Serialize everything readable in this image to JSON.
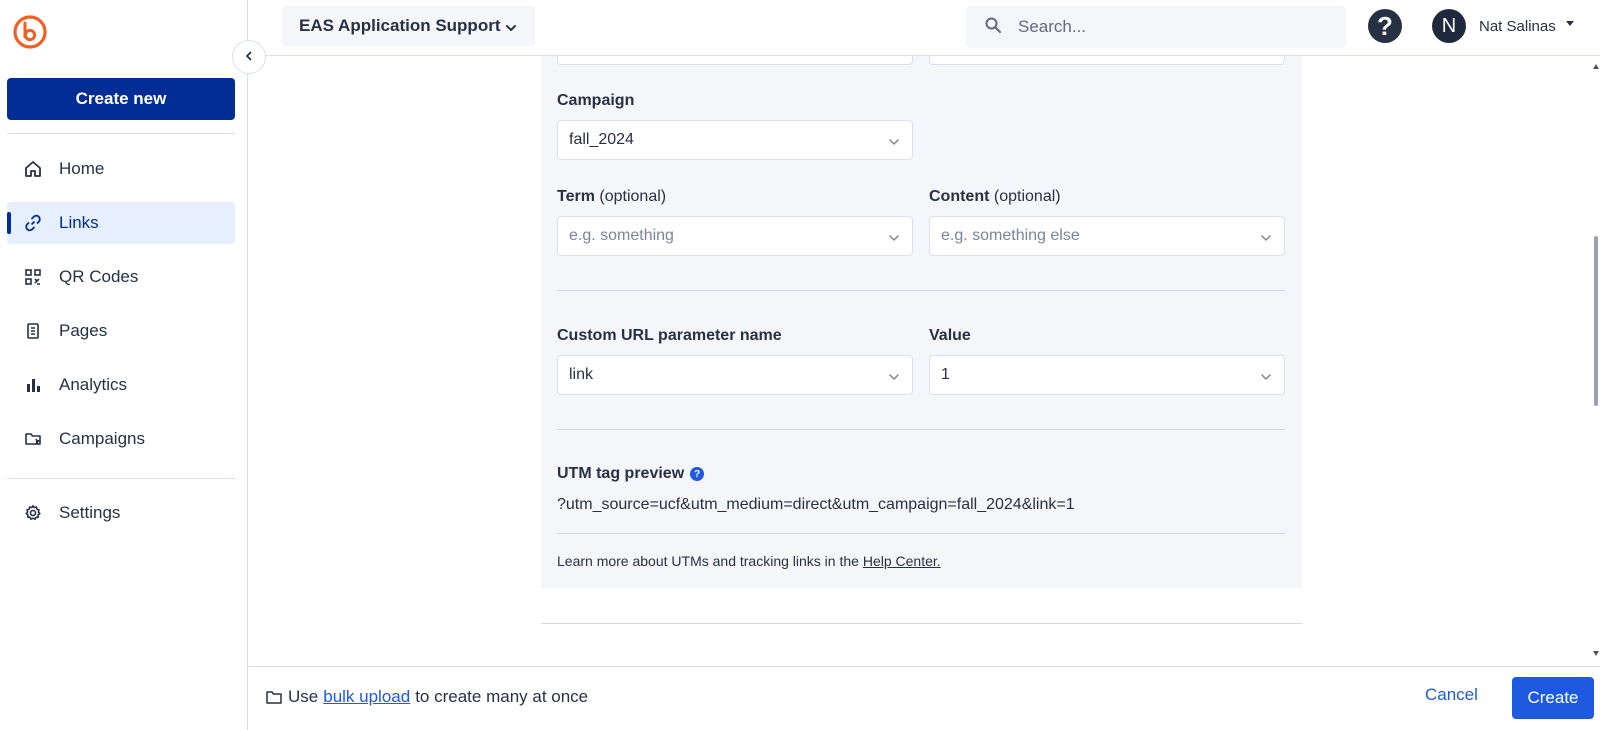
{
  "app": {
    "logo": "bitly-logo"
  },
  "sidebar": {
    "create_label": "Create new",
    "items": [
      {
        "label": "Home",
        "icon": "home-icon"
      },
      {
        "label": "Links",
        "icon": "link-icon",
        "active": true
      },
      {
        "label": "QR Codes",
        "icon": "qr-code-icon"
      },
      {
        "label": "Pages",
        "icon": "page-icon"
      },
      {
        "label": "Analytics",
        "icon": "bar-chart-icon"
      },
      {
        "label": "Campaigns",
        "icon": "campaign-folder-icon"
      },
      {
        "label": "Settings",
        "icon": "gear-icon"
      }
    ]
  },
  "header": {
    "workspace": "EAS Application Support",
    "search_placeholder": "Search...",
    "help": "?",
    "avatar_initial": "N",
    "user_name": "Nat Salinas"
  },
  "form": {
    "campaign_label": "Campaign",
    "campaign_value": "fall_2024",
    "term_label": "Term",
    "term_optional": "(optional)",
    "term_placeholder": "e.g. something",
    "content_label": "Content",
    "content_optional": "(optional)",
    "content_placeholder": "e.g. something else",
    "custom_param_label": "Custom URL parameter name",
    "custom_param_value": "link",
    "value_label": "Value",
    "value_value": "1",
    "utm_preview_label": "UTM tag preview",
    "utm_preview_value": "?utm_source=ucf&utm_medium=direct&utm_campaign=fall_2024&link=1",
    "learn_more_prefix": "Learn more about UTMs and tracking links in the",
    "learn_more_link": "Help Center."
  },
  "footer": {
    "bulk_prefix": "Use",
    "bulk_link": "bulk upload",
    "bulk_suffix": "to create many at once",
    "cancel_label": "Cancel",
    "create_label": "Create"
  },
  "colors": {
    "primary_dark": "#022d94",
    "primary": "#1e5ae0",
    "logo_orange": "#ee6123",
    "panel_bg": "#f4f6fa"
  }
}
